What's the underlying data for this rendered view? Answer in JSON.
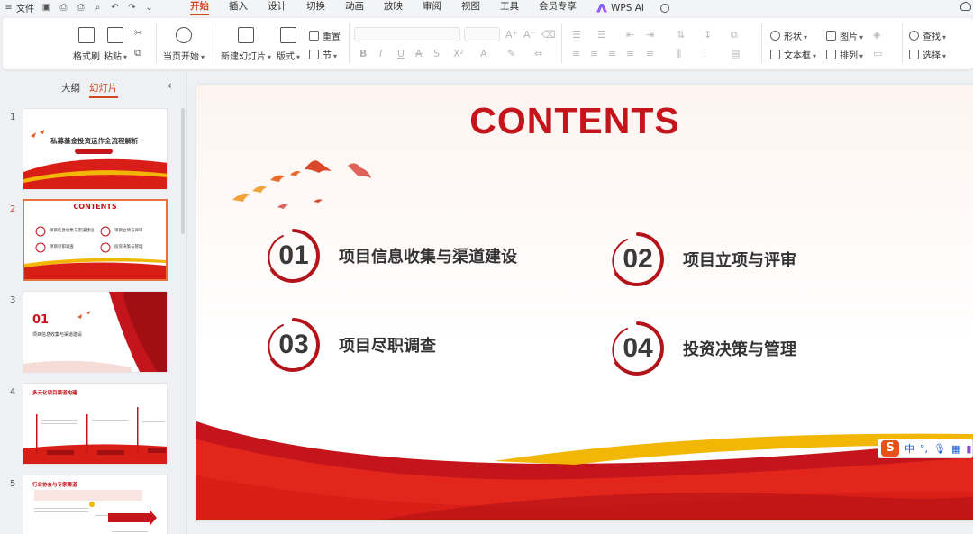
{
  "menubar": {
    "file_label": "文件",
    "tabs": [
      "开始",
      "插入",
      "设计",
      "切换",
      "动画",
      "放映",
      "审阅",
      "视图",
      "工具",
      "会员专享"
    ],
    "active_tab": "开始",
    "ai_label": "WPS AI"
  },
  "ribbon": {
    "format_painter": "格式刷",
    "paste": "粘贴",
    "from_current": "当页开始",
    "new_slide": "新建幻灯片",
    "layout": "版式",
    "reset": "重置",
    "section": "节",
    "shape": "形状",
    "picture": "图片",
    "textbox": "文本框",
    "arrange": "排列",
    "find": "查找",
    "select": "选择"
  },
  "panel": {
    "outline_tab": "大纲",
    "slides_tab": "幻灯片",
    "slide_numbers": [
      "1",
      "2",
      "3",
      "4",
      "5"
    ],
    "thumb1_title": "私募基金投资运作全流程解析",
    "thumb2_title": "CONTENTS",
    "thumb2_items": [
      "项目信息收集与渠道建设",
      "项目立项与评审",
      "项目尽职调查",
      "投资决策与管理"
    ],
    "thumb3_num": "01",
    "thumb3_title": "项目信息收集与渠道建设",
    "thumb4_title": "多元化项目渠道构建",
    "thumb5_title": "行业协会与专家渠道"
  },
  "slide": {
    "title": "CONTENTS",
    "items": [
      {
        "num": "01",
        "label": "项目信息收集与渠道建设"
      },
      {
        "num": "02",
        "label": "项目立项与评审"
      },
      {
        "num": "03",
        "label": "项目尽职调查"
      },
      {
        "num": "04",
        "label": "投资决策与管理"
      }
    ]
  },
  "ime": {
    "logo": "S",
    "lang": "中",
    "punct": "°,"
  },
  "colors": {
    "accent": "#d0491e",
    "title_red": "#c5151c",
    "wave_red": "#d91e18",
    "wave_gold": "#f2b705"
  }
}
